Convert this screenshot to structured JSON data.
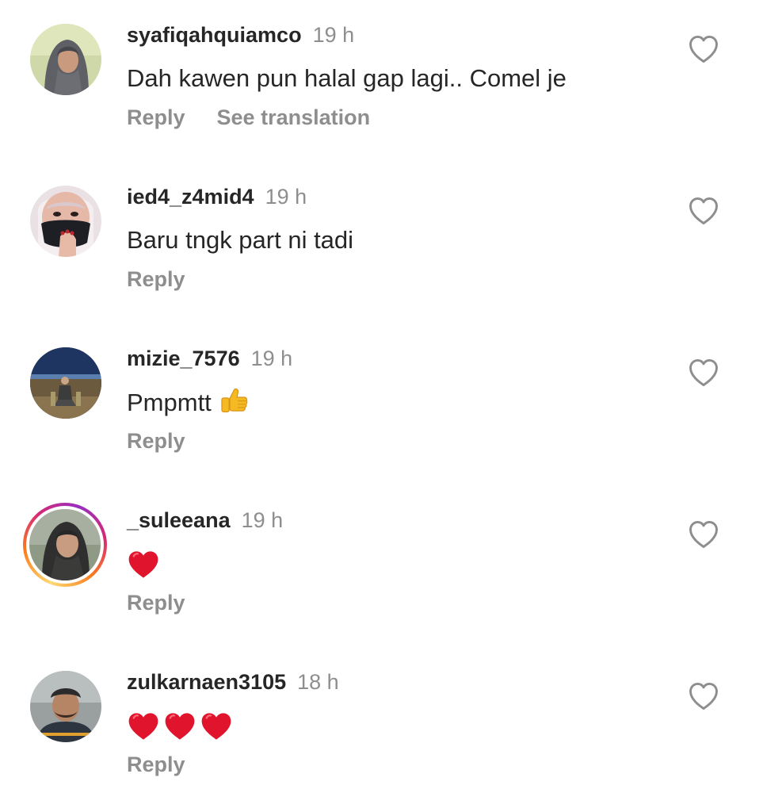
{
  "comments": [
    {
      "username": "syafiqahquiamco",
      "time": "19 h",
      "text": "Dah kawen pun halal gap lagi.. Comel je",
      "reply_label": "Reply",
      "translate_label": "See translation",
      "avatar": "woman-in-grey-hijab"
    },
    {
      "username": "ied4_z4mid4",
      "time": "19 h",
      "text": "Baru tngk part ni tadi",
      "reply_label": "Reply",
      "avatar": "person-with-black-face-mask"
    },
    {
      "username": "mizie_7576",
      "time": "19 h",
      "text": "Pmpmtt",
      "emoji": "thumbs-up",
      "reply_label": "Reply",
      "avatar": "man-sitting-on-beach-at-night"
    },
    {
      "username": "_suleeana",
      "time": "19 h",
      "emoji": [
        "red-heart"
      ],
      "reply_label": "Reply",
      "avatar": "woman-in-dark-hijab",
      "story_ring": true
    },
    {
      "username": "zulkarnaen3105",
      "time": "18 h",
      "emoji": [
        "red-heart",
        "red-heart",
        "red-heart"
      ],
      "reply_label": "Reply",
      "avatar": "man-in-cap"
    }
  ],
  "colors": {
    "text_primary": "#262626",
    "text_secondary": "#8e8e8e",
    "heart_red": "#e0142c",
    "thumbs_yellow": "#f5b922",
    "story_ring": [
      "#feda75",
      "#fa7e1e",
      "#d62976",
      "#962fbf"
    ]
  }
}
